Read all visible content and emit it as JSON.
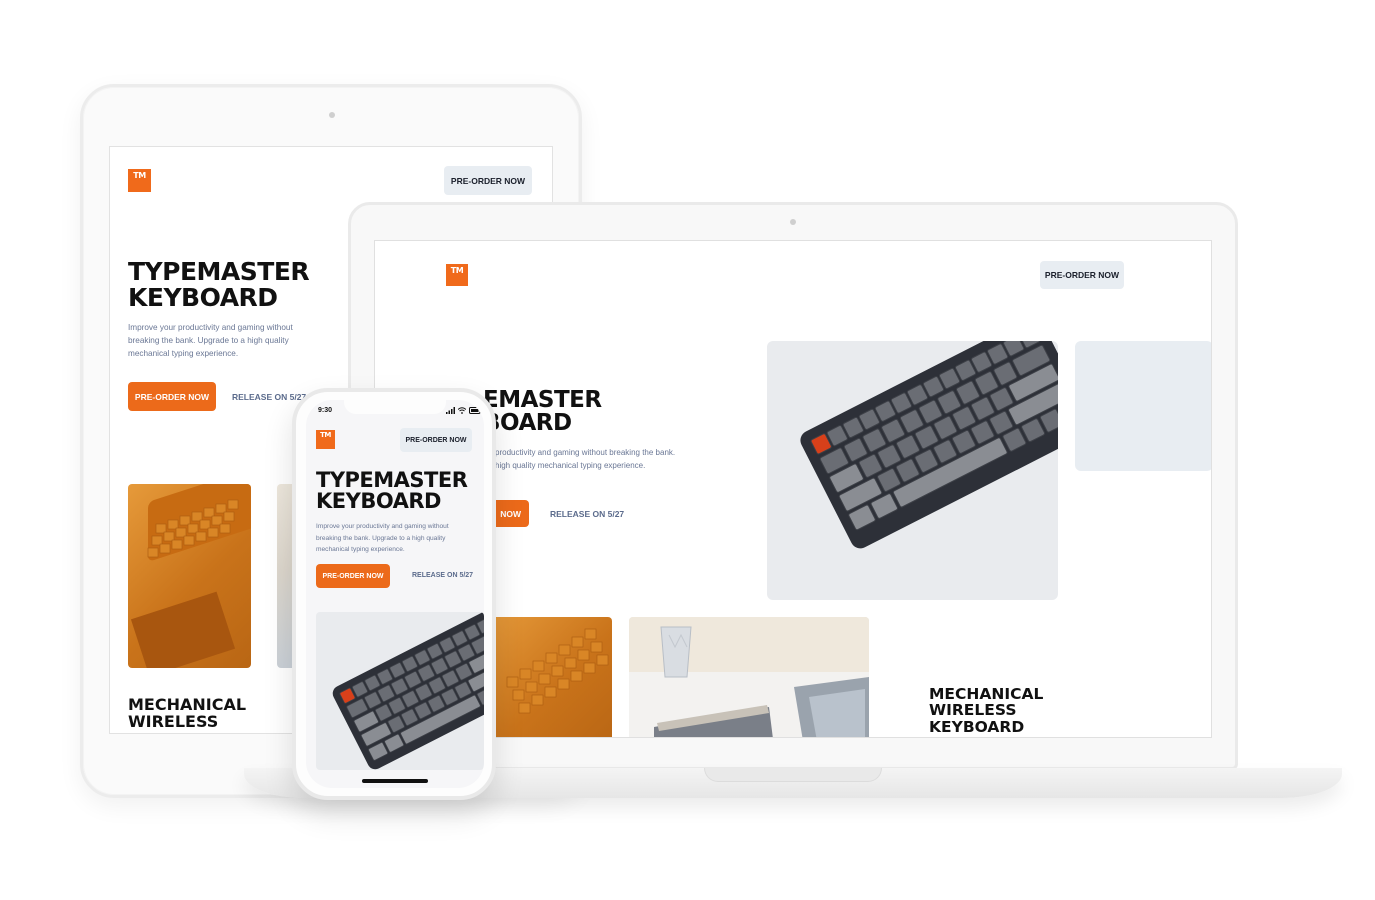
{
  "brand": {
    "logo_text": "TM",
    "accent": "#ec6a1a"
  },
  "cta": {
    "preorder_label": "PRE-ORDER NOW",
    "release_label": "RELEASE ON 5/27"
  },
  "hero": {
    "title_line1": "TYPEMASTER",
    "title_line2": "KEYBOARD",
    "description": "Improve your productivity and gaming without breaking the bank. Upgrade to a high quality mechanical typing experience."
  },
  "laptop": {
    "title_line1": "EMASTER",
    "title_line2": "BOARD",
    "description_line1": "productivity and gaming without breaking the bank.",
    "description_line2": "high quality mechanical typing experience.",
    "preorder_partial": "NOW"
  },
  "tablet": {
    "release_partial": "RELEASE ON 5/27"
  },
  "features": {
    "line1": "MECHANICAL",
    "line2": "WIRELESS",
    "line3": "KEYBOARD"
  },
  "phone": {
    "time": "9:30"
  }
}
